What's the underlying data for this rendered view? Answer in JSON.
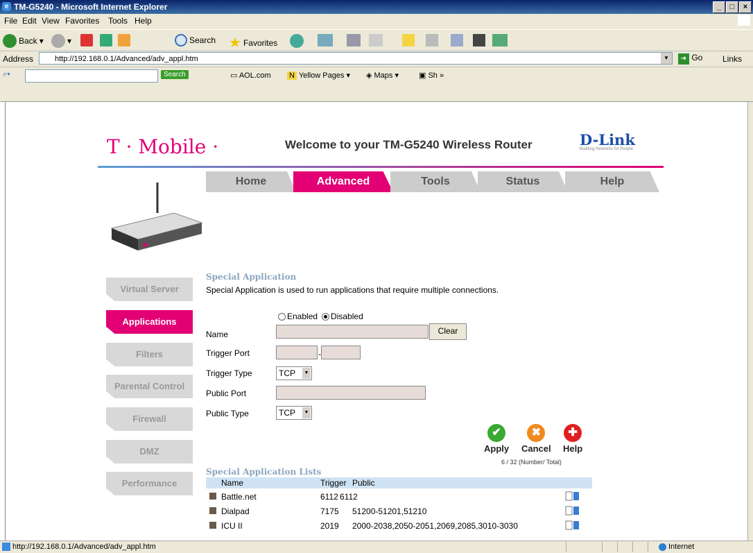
{
  "window": {
    "title": "TM-G5240 - Microsoft Internet Explorer",
    "controls": [
      "_",
      "□",
      "×"
    ]
  },
  "menu": [
    "File",
    "Edit",
    "View",
    "Favorites",
    "Tools",
    "Help"
  ],
  "toolbar": {
    "back": "Back",
    "search": "Search",
    "favorites": "Favorites"
  },
  "address": {
    "label": "Address",
    "url": "http://192.168.0.1/Advanced/adv_appl.htm",
    "go": "Go",
    "links": "Links"
  },
  "searchbar": {
    "search_btn": "Search",
    "items": [
      "AOL.com",
      "Yellow Pages",
      "Maps",
      "Sh"
    ]
  },
  "header": {
    "brand_left": "T · Mobile ·",
    "welcome": "Welcome to your TM-G5240 Wireless Router",
    "brand_right": "D-Link",
    "brand_tagline": "Building Networks for People"
  },
  "tabs": [
    {
      "label": "Home",
      "active": false
    },
    {
      "label": "Advanced",
      "active": true
    },
    {
      "label": "Tools",
      "active": false
    },
    {
      "label": "Status",
      "active": false
    },
    {
      "label": "Help",
      "active": false
    }
  ],
  "leftnav": [
    {
      "label": "Virtual Server",
      "active": false
    },
    {
      "label": "Applications",
      "active": true
    },
    {
      "label": "Filters",
      "active": false
    },
    {
      "label": "Parental Control",
      "active": false
    },
    {
      "label": "Firewall",
      "active": false
    },
    {
      "label": "DMZ",
      "active": false
    },
    {
      "label": "Performance",
      "active": false
    }
  ],
  "special": {
    "title": "Special Application",
    "description": "Special Application is used to run applications that require multiple connections.",
    "enabled_label": "Enabled",
    "disabled_label": "Disabled",
    "selected": "Disabled"
  },
  "form": {
    "name_label": "Name",
    "name_value": "",
    "clear_label": "Clear",
    "trigger_port_label": "Trigger Port",
    "trigger_port_sep": "-",
    "trigger_type_label": "Trigger Type",
    "trigger_type_value": "TCP",
    "public_port_label": "Public Port",
    "public_type_label": "Public Type",
    "public_type_value": "TCP"
  },
  "actions": {
    "apply": "Apply",
    "cancel": "Cancel",
    "help": "Help"
  },
  "list": {
    "title": "Special Application Lists",
    "count": "6 / 32 (Number/ Total)",
    "headers": {
      "name": "Name",
      "trigger": "Trigger",
      "public": "Public"
    },
    "rows": [
      {
        "name": "Battle.net",
        "trigger": "6112",
        "public": "6112"
      },
      {
        "name": "Dialpad",
        "trigger": "7175",
        "public": "51200-51201,51210"
      },
      {
        "name": "ICU II",
        "trigger": "2019",
        "public": "2000-2038,2050-2051,2069,2085,3010-3030"
      }
    ]
  },
  "status": {
    "url": "http://192.168.0.1/Advanced/adv_appl.htm",
    "zone": "Internet"
  },
  "colors": {
    "accent": "#e20074",
    "nav_inactive": "#d8d8d8",
    "list_header": "#cfe3f4"
  }
}
